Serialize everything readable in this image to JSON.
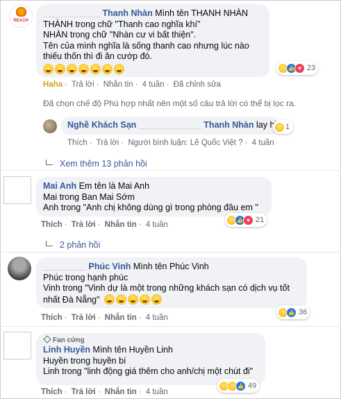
{
  "thread": [
    {
      "id": "thanh-nhan",
      "author": "Thanh Nhàn",
      "lines": [
        "Mình tên THANH NHÀN",
        "THÀNH trong chữ \"Thanh cao nghĩa khí\"",
        "NHÀN trong chữ \"Nhàn cư vi bất thiện\".",
        "Tên của mình nghĩa là sống thanh cao nhưng lúc nào",
        "thiếu thốn thì đi ăn cướp đó."
      ],
      "avatar_text": "REACH",
      "reaction_count": "23",
      "actions": {
        "reaction": "Haha",
        "reply": "Trả lời",
        "message": "Nhắn tin",
        "time": "4 tuần",
        "edited": "Đã chỉnh sửa"
      }
    }
  ],
  "filter_notice": "Đã chọn chế độ Phù hợp nhất nên một số câu trả lời có thể bị lọc ra.",
  "reply": {
    "author": "Nghề Khách Sạn",
    "mention": "Thanh Nhàn",
    "text": "lay hồn",
    "reaction_count": "1",
    "actions": {
      "like": "Thích",
      "reply": "Trả lời",
      "commenter": "Người bình luận: Lê Quốc Việt ?",
      "time": "4 tuần"
    }
  },
  "more_replies_1": "Xem thêm 13 phản hồi",
  "mai_anh": {
    "author": "Mai Anh",
    "lines": [
      "Em tên là Mai Anh",
      "Mai trong Ban Mai Sớm",
      "Anh trong \"Anh chị không dùng gì trong phòng đâu em \""
    ],
    "reaction_count": "21",
    "actions": {
      "like": "Thích",
      "reply": "Trả lời",
      "message": "Nhắn tin",
      "time": "4 tuần"
    }
  },
  "more_replies_2": "2 phản hồi",
  "phuc_vinh": {
    "author": "Phúc Vinh",
    "lines": [
      "Mình tên Phúc Vinh",
      "Phúc trong hạnh phúc",
      "Vinh trong \"Vinh dự là một trong những khách sạn có dịch vụ tốt",
      "nhất Đà Nẵng\""
    ],
    "reaction_count": "36",
    "actions": {
      "like": "Thích",
      "reply": "Trả lời",
      "message": "Nhắn tin",
      "time": "4 tuần"
    }
  },
  "huyen_linh": {
    "badge": "Fan cứng",
    "author": "Linh Huyền",
    "lines": [
      "Mình tên Huyền Linh",
      "Huyền trong huyền bí",
      "Linh trong \"linh động giá thêm cho anh/chị một chút đi\""
    ],
    "reaction_count": "49",
    "actions": {
      "like": "Thích",
      "reply": "Trả lời",
      "message": "Nhắn tin",
      "time": "4 tuần"
    }
  },
  "colors": {
    "link": "#385898",
    "bubble": "#f0f2f5",
    "muted": "#65676b",
    "haha": "#d0a319"
  }
}
